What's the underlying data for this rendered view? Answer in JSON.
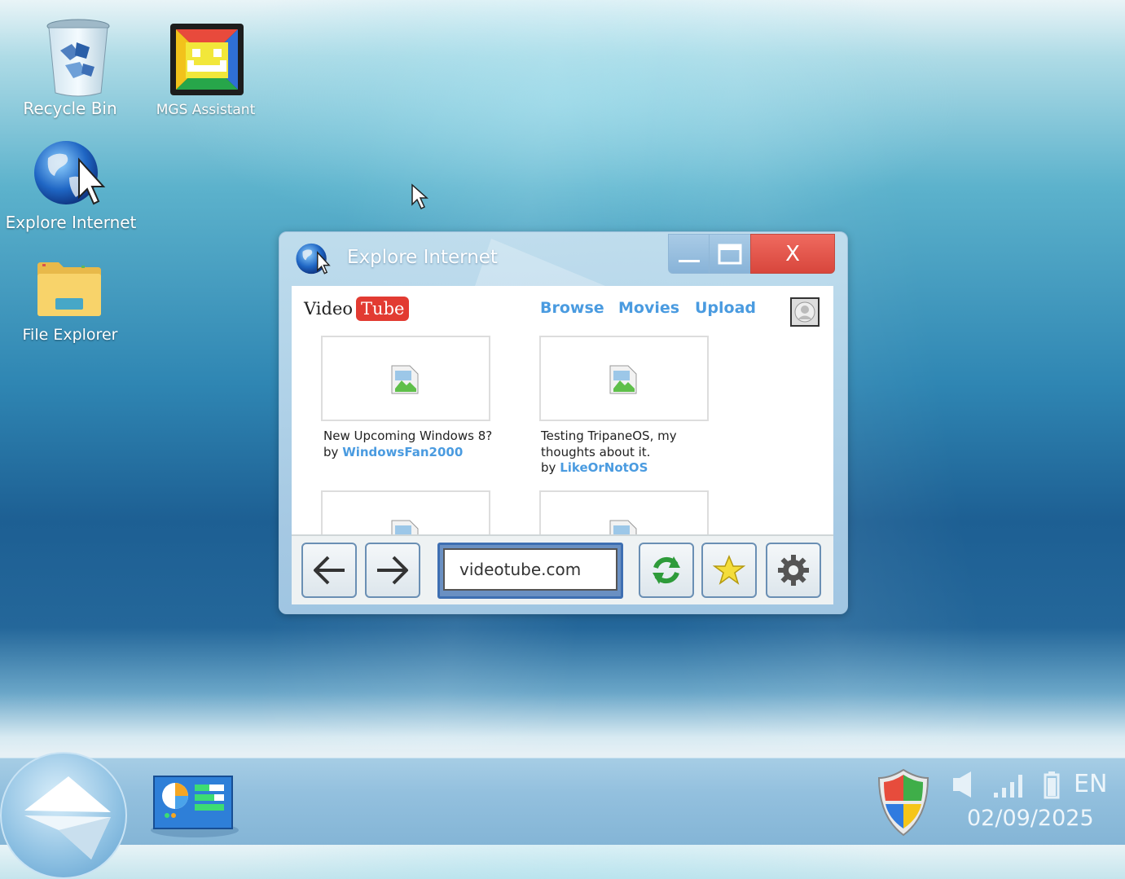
{
  "desktop": {
    "icons": [
      {
        "label": "Recycle Bin"
      },
      {
        "label": "MGS Assistant"
      },
      {
        "label": "Explore Internet"
      },
      {
        "label": "File Explorer"
      }
    ]
  },
  "window": {
    "title": "Explore Internet",
    "controls": {
      "minimize": "_",
      "maximize": "□",
      "close": "X"
    },
    "site": {
      "logo_left": "Video",
      "logo_right": "Tube",
      "nav": [
        "Browse",
        "Movies",
        "Upload"
      ],
      "videos": [
        {
          "title": "New Upcoming Windows 8?",
          "by": "by",
          "author": "WindowsFan2000"
        },
        {
          "title": "Testing TripaneOS, my thoughts about it.",
          "by": "by",
          "author": "LikeOrNotOS"
        }
      ]
    },
    "toolbar": {
      "address": "videotube.com"
    }
  },
  "taskbar": {
    "language": "EN",
    "date": "02/09/2025"
  },
  "colors": {
    "accent_link": "#4a9be0",
    "close_button": "#e0554b",
    "tube_red": "#e23b32"
  }
}
